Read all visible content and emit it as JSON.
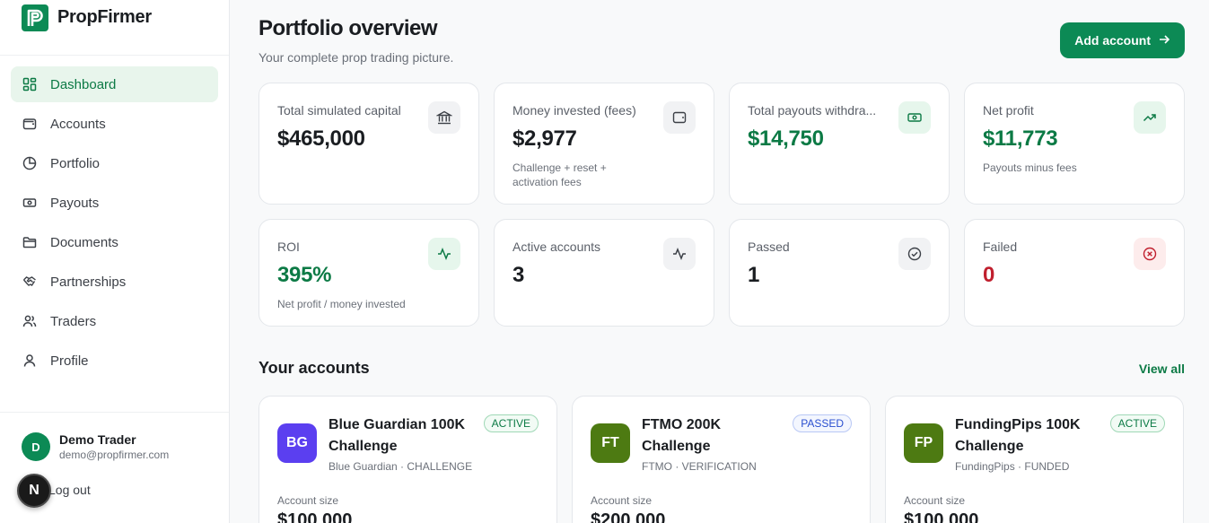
{
  "brand": {
    "name": "PropFirmer"
  },
  "nav": [
    {
      "label": "Dashboard",
      "icon": "dashboard-icon",
      "active": true
    },
    {
      "label": "Accounts",
      "icon": "wallet-icon"
    },
    {
      "label": "Portfolio",
      "icon": "pie-chart-icon"
    },
    {
      "label": "Payouts",
      "icon": "banknote-icon"
    },
    {
      "label": "Documents",
      "icon": "folder-icon"
    },
    {
      "label": "Partnerships",
      "icon": "handshake-icon"
    },
    {
      "label": "Traders",
      "icon": "users-icon"
    },
    {
      "label": "Profile",
      "icon": "user-icon"
    }
  ],
  "user": {
    "initial": "D",
    "name": "Demo Trader",
    "email": "demo@propfirmer.com",
    "logout": "Log out"
  },
  "fab": {
    "label": "N"
  },
  "header": {
    "title": "Portfolio overview",
    "subtitle": "Your complete prop trading picture.",
    "add_button": "Add account"
  },
  "stats": [
    {
      "label": "Total simulated capital",
      "value": "$465,000",
      "note": "",
      "icon": "bank-icon",
      "tone": "neutral"
    },
    {
      "label": "Money invested (fees)",
      "value": "$2,977",
      "note": "Challenge + reset + activation fees",
      "icon": "wallet-icon",
      "tone": "neutral"
    },
    {
      "label": "Total payouts withdra...",
      "value": "$14,750",
      "note": "",
      "icon": "banknote-icon",
      "tone": "green"
    },
    {
      "label": "Net profit",
      "value": "$11,773",
      "note": "Payouts minus fees",
      "icon": "trending-up-icon",
      "tone": "green"
    },
    {
      "label": "ROI",
      "value": "395%",
      "note": "Net profit / money invested",
      "icon": "activity-icon",
      "tone": "green"
    },
    {
      "label": "Active accounts",
      "value": "3",
      "note": "",
      "icon": "activity-icon",
      "tone": "neutral"
    },
    {
      "label": "Passed",
      "value": "1",
      "note": "",
      "icon": "check-circle-icon",
      "tone": "neutral"
    },
    {
      "label": "Failed",
      "value": "0",
      "note": "",
      "icon": "x-circle-icon",
      "tone": "red"
    }
  ],
  "accounts_section": {
    "title": "Your accounts",
    "view_all": "View all"
  },
  "accounts": [
    {
      "initials": "BG",
      "color": "#5b3ff0",
      "name": "Blue Guardian 100K Challenge",
      "meta": "Blue Guardian · CHALLENGE",
      "status": "ACTIVE",
      "size_label": "Account size",
      "size": "$100,000"
    },
    {
      "initials": "FT",
      "color": "#4d7a12",
      "name": "FTMO 200K Challenge",
      "meta": "FTMO · VERIFICATION",
      "status": "PASSED",
      "size_label": "Account size",
      "size": "$200,000"
    },
    {
      "initials": "FP",
      "color": "#4d7a12",
      "name": "FundingPips 100K Challenge",
      "meta": "FundingPips · FUNDED",
      "status": "ACTIVE",
      "size_label": "Account size",
      "size": "$100,000"
    }
  ],
  "colors": {
    "accent": "#0c8a55",
    "accent_text": "#0c7a45",
    "danger": "#c01f2e"
  }
}
